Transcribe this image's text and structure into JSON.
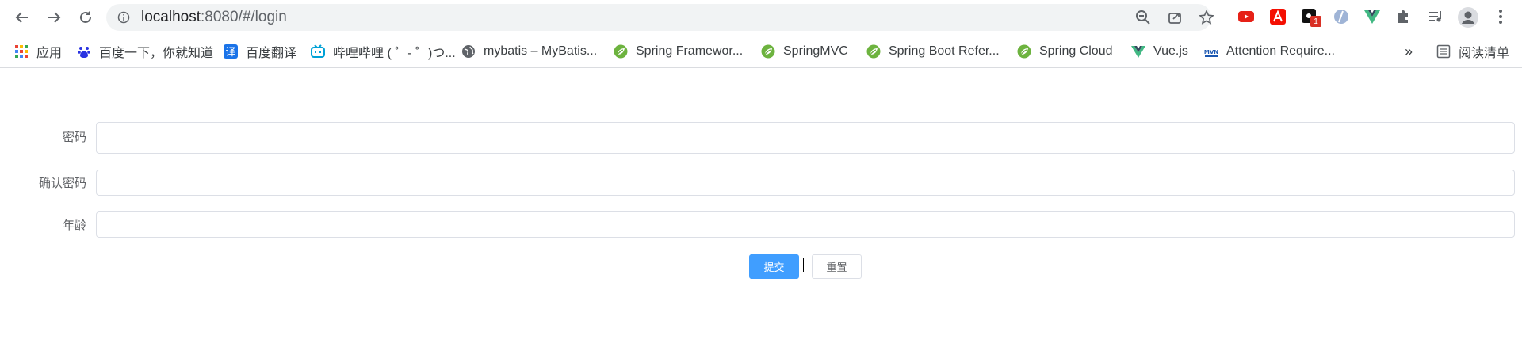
{
  "browser": {
    "url_host": "localhost",
    "url_rest": ":8080/#/login",
    "extensions": [
      "youtube-icon",
      "acrobat-icon",
      "notion-icon",
      "vpn-icon",
      "vue-devtools-icon",
      "puzzle-icon",
      "reading-list-icon",
      "profile-icon",
      "menu-icon"
    ],
    "ext_badge": "1"
  },
  "bookmarks": [
    {
      "label": "应用",
      "icon": "apps-icon"
    },
    {
      "label": "百度一下，你就知道",
      "icon": "baidu-icon"
    },
    {
      "label": "百度翻译",
      "icon": "translate-icon"
    },
    {
      "label": "哔哩哔哩 ( ゜- ゜)つ...",
      "icon": "bilibili-icon"
    },
    {
      "label": "mybatis – MyBatis...",
      "icon": "globe-icon"
    },
    {
      "label": "Spring Framewor...",
      "icon": "spring-icon"
    },
    {
      "label": "SpringMVC",
      "icon": "spring-icon"
    },
    {
      "label": "Spring Boot Refer...",
      "icon": "spring-icon"
    },
    {
      "label": "Spring Cloud",
      "icon": "spring-icon"
    },
    {
      "label": "Vue.js",
      "icon": "vue-icon"
    },
    {
      "label": "Attention Require...",
      "icon": "mvn-icon"
    }
  ],
  "bookmarks_more": "»",
  "reading_list_label": "阅读清单",
  "form": {
    "password_label": "密码",
    "confirm_password_label": "确认密码",
    "age_label": "年龄",
    "password_value": "",
    "confirm_password_value": "",
    "age_value": "",
    "submit_label": "提交",
    "reset_label": "重置"
  },
  "colors": {
    "primary": "#409eff",
    "label": "#606266",
    "border": "#dcdfe6"
  }
}
